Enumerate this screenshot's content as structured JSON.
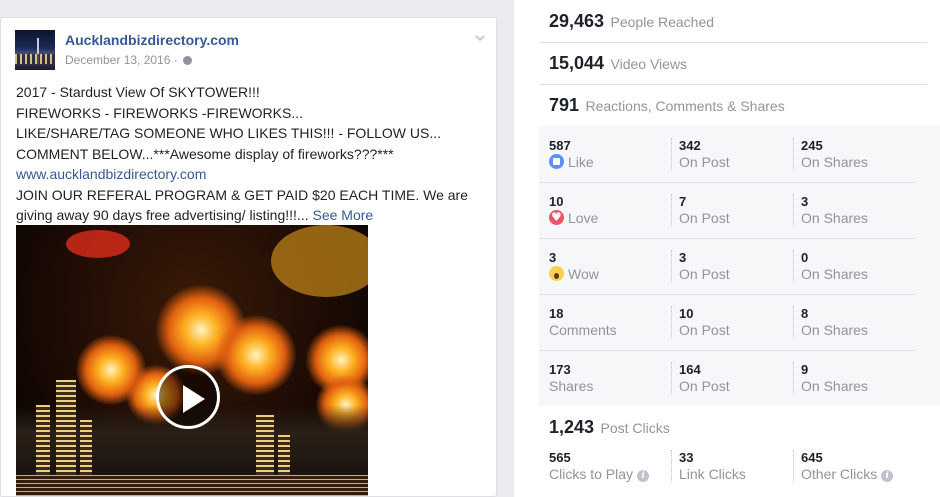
{
  "post": {
    "page_name": "Aucklandbizdirectory.com",
    "date": "December 13, 2016",
    "date_sep": "·",
    "lines": [
      "2017 - Stardust View Of SKYTOWER!!!",
      "FIREWORKS - FIREWORKS -FIREWORKS...",
      "LIKE/SHARE/TAG SOMEONE WHO LIKES THIS!!! - FOLLOW US...",
      "COMMENT BELOW...***Awesome display of fireworks???***"
    ],
    "link": "www.aucklandbizdirectory.com",
    "line_after_link_1": "JOIN OUR REFERAL PROGRAM & GET PAID $20 EACH TIME. We are",
    "line_after_link_2": "giving away 90 days free advertising/ listing!!!...",
    "see_more": "See More"
  },
  "stats": {
    "reached": {
      "value": "29,463",
      "label": "People Reached"
    },
    "views": {
      "value": "15,044",
      "label": "Video Views"
    },
    "engagement": {
      "value": "791",
      "label": "Reactions, Comments & Shares"
    },
    "breakdown": [
      {
        "total": "587",
        "total_label": "Like",
        "icon": "like-icon",
        "on_post": "342",
        "on_post_label": "On Post",
        "on_shares": "245",
        "on_shares_label": "On Shares"
      },
      {
        "total": "10",
        "total_label": "Love",
        "icon": "love-icon",
        "on_post": "7",
        "on_post_label": "On Post",
        "on_shares": "3",
        "on_shares_label": "On Shares"
      },
      {
        "total": "3",
        "total_label": "Wow",
        "icon": "wow-icon",
        "on_post": "3",
        "on_post_label": "On Post",
        "on_shares": "0",
        "on_shares_label": "On Shares"
      },
      {
        "total": "18",
        "total_label": "Comments",
        "on_post": "10",
        "on_post_label": "On Post",
        "on_shares": "8",
        "on_shares_label": "On Shares"
      },
      {
        "total": "173",
        "total_label": "Shares",
        "on_post": "164",
        "on_post_label": "On Post",
        "on_shares": "9",
        "on_shares_label": "On Shares"
      }
    ],
    "post_clicks": {
      "value": "1,243",
      "label": "Post Clicks"
    },
    "clicks": [
      {
        "value": "565",
        "label": "Clicks to Play"
      },
      {
        "value": "33",
        "label": "Link Clicks"
      },
      {
        "value": "645",
        "label": "Other Clicks"
      }
    ]
  },
  "colors": {
    "link": "#365899",
    "muted": "#90949c",
    "like": "#5890ff",
    "love": "#f25268",
    "wow": "#f7d04c"
  }
}
